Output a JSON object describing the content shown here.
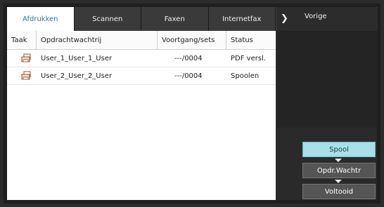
{
  "tabs": [
    "Afdrukken",
    "Scannen",
    "Faxen",
    "Internetfax"
  ],
  "back": {
    "label": "Vorige"
  },
  "table": {
    "headers": [
      "Taak",
      "Opdrachtwachtrij",
      "Voortgang/sets",
      "Status"
    ],
    "rows": [
      {
        "name": "User_1_User_1_User",
        "progress": "---/0004",
        "status": "PDF versl."
      },
      {
        "name": "User_2_User_2_User",
        "progress": "---/0004",
        "status": "Spoolen"
      }
    ]
  },
  "side_buttons": [
    "Spool",
    "Opdr.Wachtr",
    "Voltooid"
  ],
  "colors": {
    "active_tab_text": "#1f7aa8",
    "spool_active": "#a8e0e8"
  }
}
